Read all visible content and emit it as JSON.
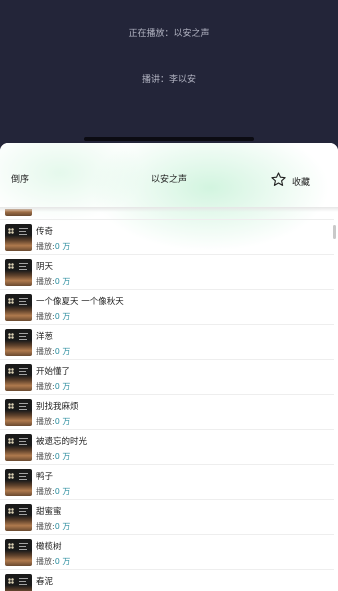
{
  "player": {
    "now_playing": "正在播放：以安之声",
    "narrator": "播讲：李以安"
  },
  "sheet": {
    "reverse_label": "倒序",
    "title": "以安之声",
    "favorite_label": "收藏"
  },
  "plays_label": "播放:",
  "songs": [
    {
      "title": "",
      "plays": ""
    },
    {
      "title": "传奇",
      "plays": "0 万"
    },
    {
      "title": "阴天",
      "plays": "0 万"
    },
    {
      "title": "一个像夏天 一个像秋天",
      "plays": "0 万"
    },
    {
      "title": "洋葱",
      "plays": "0 万"
    },
    {
      "title": "开始懂了",
      "plays": "0 万"
    },
    {
      "title": "别找我麻烦",
      "plays": "0 万"
    },
    {
      "title": "被遗忘的时光",
      "plays": "0 万"
    },
    {
      "title": "鸭子",
      "plays": "0 万"
    },
    {
      "title": "甜蜜蜜",
      "plays": "0 万"
    },
    {
      "title": "橄榄树",
      "plays": "0 万"
    },
    {
      "title": "春泥",
      "plays": ""
    }
  ],
  "colors": {
    "background": "#232539",
    "accent_count": "#2e8fa0"
  },
  "icons": {
    "favorite": "star-outline-icon"
  }
}
